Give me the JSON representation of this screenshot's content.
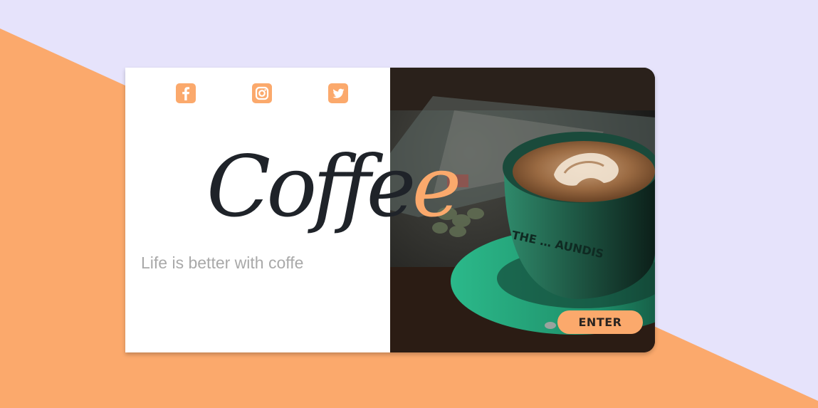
{
  "colors": {
    "background_light": "#e6e3fb",
    "background_accent": "#fba96c",
    "title_dark": "#1f2329",
    "tagline_gray": "#a9a9a9"
  },
  "social": [
    {
      "name": "facebook-icon"
    },
    {
      "name": "instagram-icon"
    },
    {
      "name": "twitter-icon"
    }
  ],
  "hero": {
    "title_main": "Coffe",
    "title_accent": "e",
    "tagline": "Life is better with coffe"
  },
  "photo": {
    "cup_text": "THE … AUNDIS"
  },
  "actions": {
    "enter_label": "ENTER"
  }
}
